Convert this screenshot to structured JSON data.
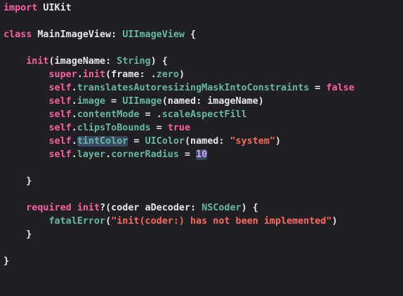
{
  "editor": {
    "language": "Swift",
    "theme_colors": {
      "background": "#1f1f24",
      "keyword": "#fc5fa3",
      "type": "#67b7a4",
      "string": "#fc6a5d",
      "number": "#d0bf69",
      "plain": "#e8e8e8",
      "highlight": "#3b4a64"
    },
    "lines": {
      "l1": {
        "t1": "import",
        "t2": " UIKit"
      },
      "l3": {
        "t1": "class",
        "t2": " MainImageView: ",
        "t3": "UIImageView",
        "t4": " {"
      },
      "l5": {
        "t0": "    ",
        "t1": "init",
        "t2": "(imageName: ",
        "t3": "String",
        "t4": ") {"
      },
      "l6": {
        "t0": "        ",
        "t1": "super",
        "t2": ".",
        "t3": "init",
        "t4": "(frame: .",
        "t5": "zero",
        "t6": ")"
      },
      "l7": {
        "t0": "        ",
        "t1": "self",
        "t2": ".",
        "t3": "translatesAutoresizingMaskIntoConstraints",
        "t4": " = ",
        "t5": "false"
      },
      "l8": {
        "t0": "        ",
        "t1": "self",
        "t2": ".",
        "t3": "image",
        "t4": " = ",
        "t5": "UIImage",
        "t6": "(named: imageName)"
      },
      "l9": {
        "t0": "        ",
        "t1": "self",
        "t2": ".",
        "t3": "contentMode",
        "t4": " = .",
        "t5": "scaleAspectFill"
      },
      "l10": {
        "t0": "        ",
        "t1": "self",
        "t2": ".",
        "t3": "clipsToBounds",
        "t4": " = ",
        "t5": "true"
      },
      "l11": {
        "t0": "        ",
        "t1": "self",
        "t2": ".",
        "t3": "tintColor",
        "t4": " = ",
        "t5": "UIColor",
        "t6": "(named: ",
        "t7": "\"system\"",
        "t8": ")"
      },
      "l12": {
        "t0": "        ",
        "t1": "self",
        "t2": ".",
        "t3": "layer",
        "t4": ".",
        "t5": "cornerRadius",
        "t6": " = ",
        "t7": "10"
      },
      "l14": {
        "t0": "    ",
        "t1": "}"
      },
      "l16": {
        "t0": "    ",
        "t1": "required",
        "t2": " ",
        "t3": "init",
        "t4": "?(coder aDecoder: ",
        "t5": "NSCoder",
        "t6": ") {"
      },
      "l17": {
        "t0": "        ",
        "t1": "fatalError",
        "t2": "(",
        "t3": "\"init(coder:) has not been implemented\"",
        "t4": ")"
      },
      "l18": {
        "t0": "    ",
        "t1": "}"
      },
      "l20": {
        "t1": "}"
      }
    }
  }
}
